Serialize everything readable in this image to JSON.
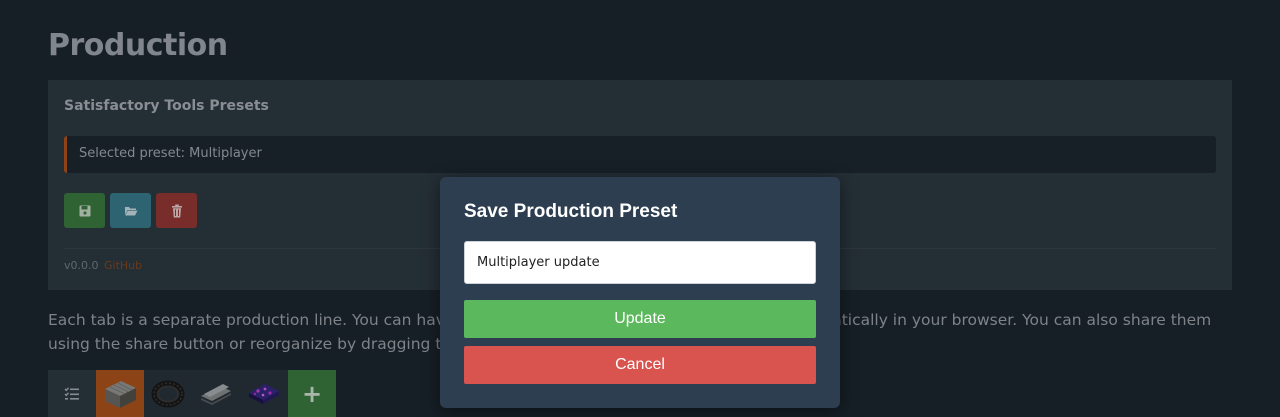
{
  "page": {
    "title": "Production",
    "description": "Each tab is a separate production line. You can have multiple production lines, they are saved automatically in your browser. You can also share them using the share button or reorganize by dragging them."
  },
  "presets": {
    "panel_title": "Satisfactory Tools Presets",
    "selected_text": "Selected preset: Multiplayer",
    "buttons": {
      "save_icon": "floppy-disk-icon",
      "open_icon": "folder-open-icon",
      "delete_icon": "trash-icon"
    },
    "version": "v0.0.0",
    "github_link": "GitHub"
  },
  "tabs": {
    "items": [
      {
        "icon": "list-icon"
      },
      {
        "icon": "concrete-item-icon",
        "active": true
      },
      {
        "icon": "cable-item-icon"
      },
      {
        "icon": "sheet-item-icon"
      },
      {
        "icon": "circuit-item-icon"
      }
    ],
    "add_label": "+"
  },
  "modal": {
    "title": "Save Production Preset",
    "input_value": "Multiplayer update",
    "update_label": "Update",
    "cancel_label": "Cancel"
  },
  "colors": {
    "background": "#1d2831",
    "panel": "#2f3b45",
    "accent_orange": "#b8551b",
    "success": "#5cb85c",
    "danger": "#d9534f",
    "info": "#3c7f91",
    "modal_bg": "#2c3e50"
  }
}
